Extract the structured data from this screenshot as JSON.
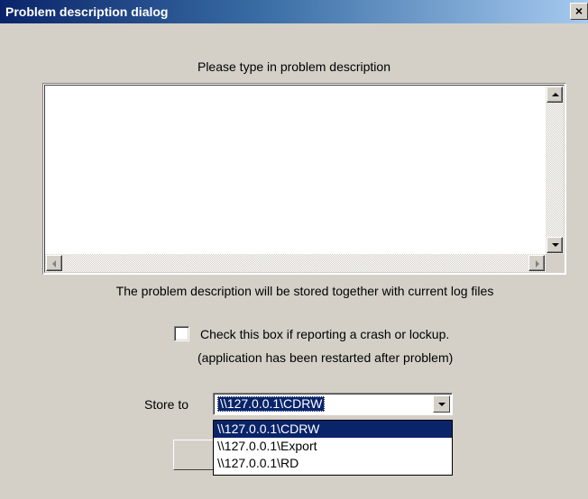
{
  "window": {
    "title": "Problem description dialog",
    "close_glyph": "×"
  },
  "prompt_label": "Please type in problem description",
  "description": {
    "value": ""
  },
  "stored_label": "The problem description will be stored together with current log files",
  "crash_checkbox": {
    "checked": false,
    "label_line1": "Check this box if reporting a crash or lockup.",
    "label_line2": "(application has been restarted after problem)"
  },
  "store_to": {
    "label": "Store to",
    "selected": "\\\\127.0.0.1\\CDRW",
    "options": [
      "\\\\127.0.0.1\\CDRW",
      "\\\\127.0.0.1\\Export",
      "\\\\127.0.0.1\\RD"
    ]
  },
  "icons": {
    "close": "close-icon",
    "scroll_up": "arrow-up-icon",
    "scroll_down": "arrow-down-icon",
    "scroll_left": "arrow-left-icon",
    "scroll_right": "arrow-right-icon",
    "combo_dropdown": "chevron-down-icon"
  },
  "colors": {
    "window_bg": "#d4d0c8",
    "title_start": "#0a246a",
    "title_end": "#a6caf0",
    "selection": "#0a246a"
  }
}
